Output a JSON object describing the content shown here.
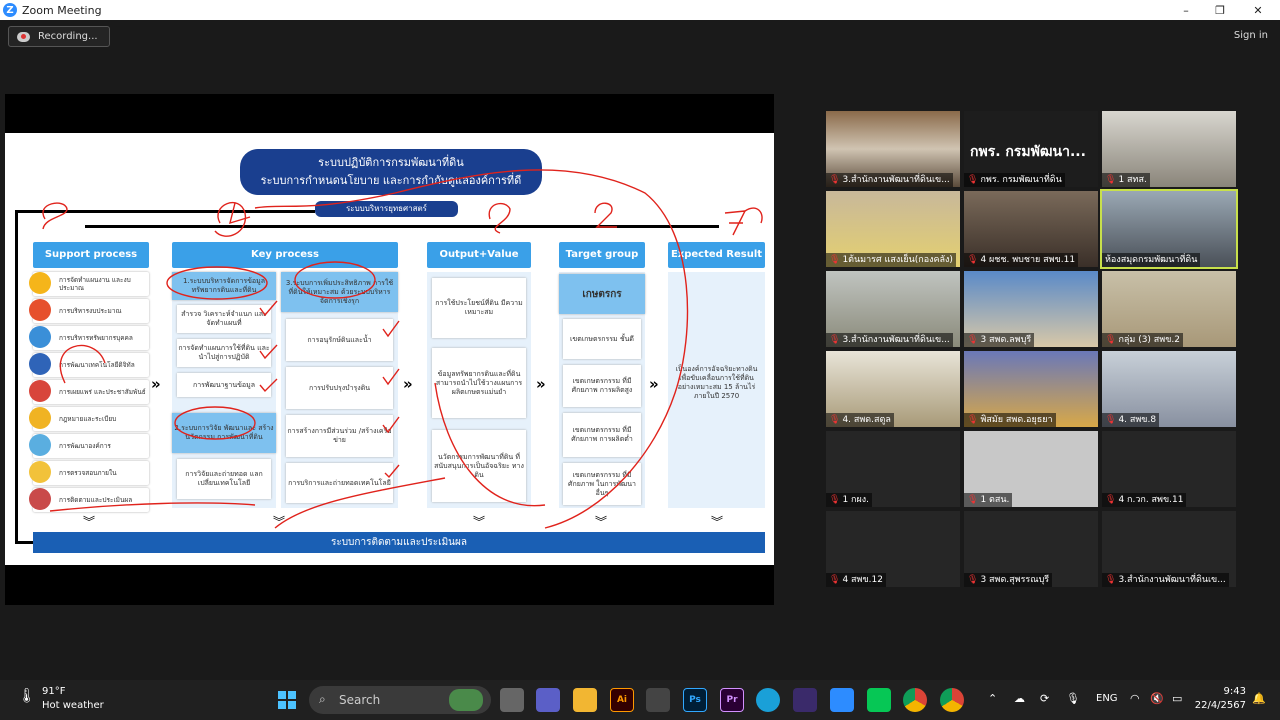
{
  "window": {
    "title": "Zoom Meeting",
    "logo": "Z"
  },
  "toolbar": {
    "recording_label": "Recording...",
    "signin_label": "Sign in"
  },
  "slide": {
    "title_line1": "ระบบปฏิบัติการกรมพัฒนาที่ดิน",
    "title_line2": "ระบบการกำหนดนโยบาย และการกำกับดูแลองค์การที่ดี",
    "subtitle": "ระบบบริหารยุทธศาสตร์",
    "headers": [
      "Support process",
      "Key process",
      "Output+Value",
      "Target group",
      "Expected Result"
    ],
    "support_items": [
      "การจัดทำแผนงาน และงบประมาณ",
      "การบริหารงบประมาณ",
      "การบริหารทรัพยากรบุคคล",
      "การพัฒนาเทคโนโลยีดิจิทัล",
      "การเผยแพร่ และประชาสัมพันธ์",
      "กฎหมายและระเบียบ",
      "การพัฒนาองค์การ",
      "การตรวจสอบภายใน",
      "การติดตามและประเมินผล"
    ],
    "key_left_head": "1.ระบบบริหารจัดการข้อมูล ทรัพยากรดินและที่ดิน",
    "key_left_items": [
      "สำรวจ วิเคราะห์จำแนก และจัดทำแผนที่",
      "การจัดทำแผนการใช้ที่ดิน และนำไปสู่การปฏิบัติ",
      "การพัฒนาฐานข้อมูล"
    ],
    "key_left_head2": "2.ระบบการวิจัย พัฒนาและ สร้างนวัตกรรม การพัฒนาที่ดิน",
    "key_left_items2": [
      "การวิจัยและถ่ายทอด แลกเปลี่ยนเทคโนโลยี"
    ],
    "key_right_head": "3.ระบบการเพิ่มประสิทธิภาพ การใช้ที่ดินให้เหมาะสม ด้วยระบบบริหารจัดการเชิงรุก",
    "key_right_items": [
      "การอนุรักษ์ดินและน้ำ",
      "การปรับปรุงบำรุงดิน",
      "การสร้างการมีส่วนร่วม /สร้างเครือข่าย",
      "การบริการและถ่ายทอดเทคโนโลยี"
    ],
    "outputs": [
      "การใช้ประโยชน์ที่ดิน มีความเหมาะสม",
      "ข้อมูลทรัพยากรดินและที่ดิน สามารถนำไปใช้วางแผนการ ผลิตเกษตรแม่นยำ",
      "นวัตกรรมการพัฒนาที่ดิน ที่สนับสนุนการเป็นอัจฉริยะ ทางดิน"
    ],
    "target_head": "เกษตรกร",
    "targets": [
      "เขตเกษตรกรรม ชั้นดี",
      "เขตเกษตรกรรม ที่มีศักยภาพ การผลิตสูง",
      "เขตเกษตรกรรม ที่มีศักยภาพ การผลิตต่ำ",
      "เขตเกษตรกรรม ที่มีศักยภาพ ในการพัฒนาอื่นๆ"
    ],
    "expected": "เป็นองค์การอัจฉริยะทางดิน เพื่อขับเคลื่อนการใช้ที่ดิน อย่างเหมาะสม 15 ล้านไร่ ภายในปี 2570",
    "bottom": "ระบบการติดตามและประเมินผล"
  },
  "participants": [
    {
      "name": "3.สำนักงานพัฒนาที่ดินเข...",
      "muted": true,
      "video": true
    },
    {
      "name": "กพร. กรมพัฒนาที่ดิน",
      "muted": true,
      "video": false,
      "display": "กพร. กรมพัฒนา..."
    },
    {
      "name": "1 สทส.",
      "muted": true,
      "video": true
    },
    {
      "name": "1ต้นมารศ แสงเย็น(กองคลัง)",
      "muted": true,
      "video": true
    },
    {
      "name": "4 ผชช. พบชาย สพข.11",
      "muted": true,
      "video": true
    },
    {
      "name": "ห้องสมุดกรมพัฒนาที่ดิน",
      "muted": false,
      "video": true,
      "active": true
    },
    {
      "name": "3.สำนักงานพัฒนาที่ดินเข...",
      "muted": true,
      "video": true
    },
    {
      "name": "3 สพด.ลพบุรี",
      "muted": true,
      "video": true
    },
    {
      "name": "กลุ่ม (3) สพข.2",
      "muted": true,
      "video": true
    },
    {
      "name": "4. สพด.สตูล",
      "muted": true,
      "video": true
    },
    {
      "name": "พิสมัย สพด.อยุธยา",
      "muted": true,
      "video": true
    },
    {
      "name": "4. สพข.8",
      "muted": true,
      "video": true
    },
    {
      "name": "1 กผง.",
      "muted": true,
      "video": false
    },
    {
      "name": "1 ตสน.",
      "muted": true,
      "video": false,
      "light": true
    },
    {
      "name": "4 ก.วก. สพข.11",
      "muted": true,
      "video": false
    },
    {
      "name": "4 สพข.12",
      "muted": true,
      "video": false
    },
    {
      "name": "3 สพด.สุพรรณบุรี",
      "muted": true,
      "video": false
    },
    {
      "name": "3.สำนักงานพัฒนาที่ดินเข...",
      "muted": true,
      "video": false
    }
  ],
  "taskbar": {
    "weather_temp": "91°F",
    "weather_desc": "Hot weather",
    "search_label": "Search",
    "lang": "ENG",
    "time": "9:43",
    "date": "22/4/2567",
    "apps": [
      "Ai",
      "Ps",
      "Pr"
    ]
  }
}
